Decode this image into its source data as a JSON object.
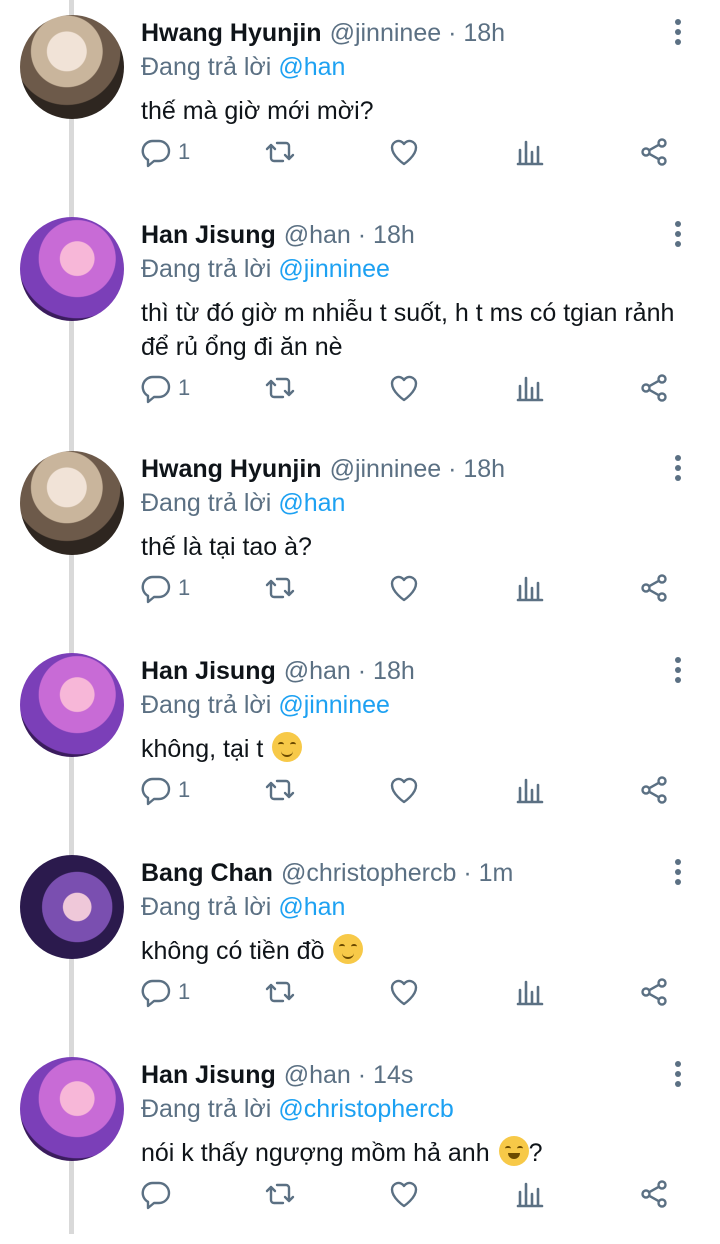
{
  "tweets": [
    {
      "name": "Hwang Hyunjin",
      "meta": "@jinninee · 18h",
      "reply_prefix": "Đang trả lời",
      "reply_to": "@han",
      "text": "thế mà giờ mới mời?",
      "emoji": "",
      "trailing": "",
      "reply_count": "1",
      "avatar": "hyunjin"
    },
    {
      "name": "Han Jisung",
      "meta": "@han · 18h",
      "reply_prefix": "Đang trả lời",
      "reply_to": "@jinninee",
      "text": "thì từ đó giờ m nhiễu t suốt, h t ms có tgian rảnh để rủ ổng đi ăn nè",
      "emoji": "",
      "trailing": "",
      "reply_count": "1",
      "avatar": "han"
    },
    {
      "name": "Hwang Hyunjin",
      "meta": "@jinninee · 18h",
      "reply_prefix": "Đang trả lời",
      "reply_to": "@han",
      "text": "thế là tại tao à?",
      "emoji": "",
      "trailing": "",
      "reply_count": "1",
      "avatar": "hyunjin"
    },
    {
      "name": "Han Jisung",
      "meta": "@han · 18h",
      "reply_prefix": "Đang trả lời",
      "reply_to": "@jinninee",
      "text": "không, tại t",
      "emoji": "smiling-face",
      "trailing": "",
      "reply_count": "1",
      "avatar": "han"
    },
    {
      "name": "Bang Chan",
      "meta": "@christophercb · 1m",
      "reply_prefix": "Đang trả lời",
      "reply_to": "@han",
      "text": "không có tiền đồ",
      "emoji": "relieved-face",
      "trailing": "",
      "reply_count": "1",
      "avatar": "chan"
    },
    {
      "name": "Han Jisung",
      "meta": "@han · 14s",
      "reply_prefix": "Đang trả lời",
      "reply_to": "@christophercb",
      "text": "nói k thấy ngượng mồm hả anh",
      "emoji": "grinning-face",
      "trailing": "?",
      "reply_count": "",
      "avatar": "han"
    }
  ],
  "colors": {
    "mention": "#1da1f2",
    "secondary_text": "#5b7083",
    "thread_line": "#d9d9d9"
  },
  "icons": [
    "reply-icon",
    "retweet-icon",
    "like-icon",
    "stats-icon",
    "share-icon",
    "more-icon"
  ]
}
